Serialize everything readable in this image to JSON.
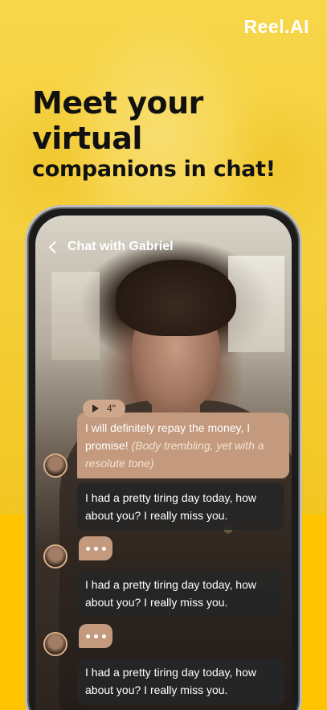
{
  "brand": {
    "logo_text": "Reel.AI"
  },
  "headline": {
    "line1": "Meet your virtual",
    "line2": "companions in chat!"
  },
  "chat": {
    "header_title": "Chat with Gabriel",
    "voice_duration": "4\"",
    "messages": [
      {
        "sender": "character",
        "type": "voice-text",
        "text": "I will definitely repay the money, I promise!",
        "action": "(Body trembling, yet with a resolute tone)"
      },
      {
        "sender": "user",
        "text": "I had a pretty tiring day today, how about you? I really miss you."
      },
      {
        "sender": "character",
        "type": "typing",
        "text": "•••"
      },
      {
        "sender": "user",
        "text": "I had a pretty tiring day today, how about you? I really miss you."
      },
      {
        "sender": "character",
        "type": "typing",
        "text": "•••"
      },
      {
        "sender": "user",
        "text": "I had a pretty tiring day today, how about you? I really miss you."
      }
    ]
  },
  "colors": {
    "background_yellow": "#ffc400",
    "character_bubble": "#c39a7e",
    "user_bubble": "#262626"
  }
}
